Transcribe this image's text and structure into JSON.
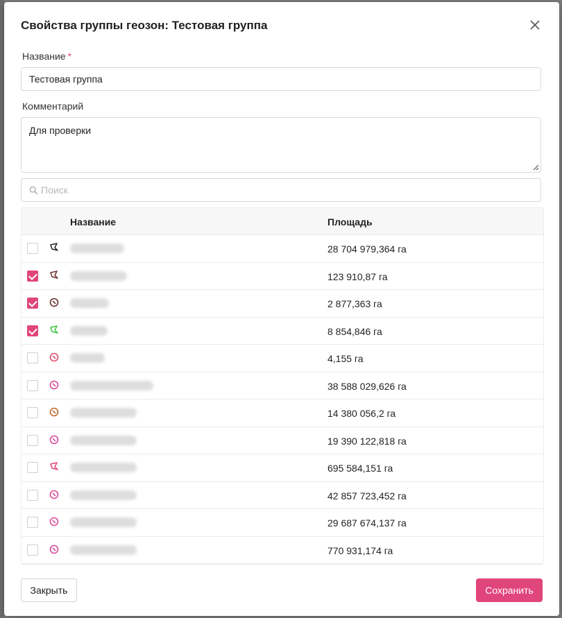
{
  "dialog": {
    "title": "Свойства группы геозон: Тестовая группа"
  },
  "form": {
    "name_label": "Название",
    "name_required_mark": "*",
    "name_value": "Тестовая группа",
    "comment_label": "Комментарий",
    "comment_value": "Для проверки",
    "search_placeholder": "Поиск"
  },
  "table": {
    "col_name": "Название",
    "col_area": "Площадь",
    "rows": [
      {
        "checked": false,
        "icon": "polygon-icon",
        "icon_color": "#222222",
        "area": "28 704 979,364 га"
      },
      {
        "checked": true,
        "icon": "polygon-icon",
        "icon_color": "#6b2f2f",
        "area": "123 910,87 га"
      },
      {
        "checked": true,
        "icon": "circle-icon",
        "icon_color": "#6b2f2f",
        "area": "2 877,363 га"
      },
      {
        "checked": true,
        "icon": "polygon-icon",
        "icon_color": "#3cc43c",
        "area": "8 854,846 га"
      },
      {
        "checked": false,
        "icon": "circle-icon",
        "icon_color": "#e0506a",
        "area": "4,155 га"
      },
      {
        "checked": false,
        "icon": "circle-icon",
        "icon_color": "#d94a9a",
        "area": "38 588 029,626 га"
      },
      {
        "checked": false,
        "icon": "circle-icon",
        "icon_color": "#c0662a",
        "area": "14 380 056,2 га"
      },
      {
        "checked": false,
        "icon": "circle-icon",
        "icon_color": "#d94a9a",
        "area": "19 390 122,818 га"
      },
      {
        "checked": false,
        "icon": "polygon-icon",
        "icon_color": "#e0457b",
        "area": "695 584,151 га"
      },
      {
        "checked": false,
        "icon": "circle-icon",
        "icon_color": "#d94a9a",
        "area": "42 857 723,452 га"
      },
      {
        "checked": false,
        "icon": "circle-icon",
        "icon_color": "#d94a9a",
        "area": "29 687 674,137 га"
      },
      {
        "checked": false,
        "icon": "circle-icon",
        "icon_color": "#d94a9a",
        "area": "770 931,174 га"
      }
    ]
  },
  "footer": {
    "close_label": "Закрыть",
    "save_label": "Сохранить"
  },
  "colors": {
    "accent": "#e0457b"
  }
}
